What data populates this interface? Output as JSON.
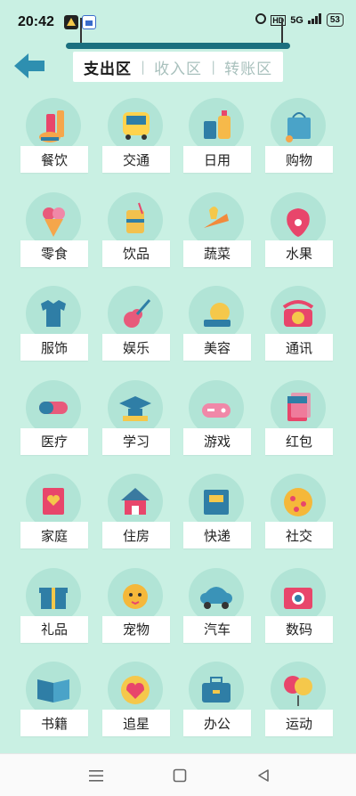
{
  "status_bar": {
    "time": "20:42",
    "battery": "53",
    "network": "5G"
  },
  "tabs": [
    {
      "label": "支出区",
      "active": true
    },
    {
      "label": "收入区",
      "active": false
    },
    {
      "label": "转账区",
      "active": false
    }
  ],
  "tab_separator": "|",
  "categories": [
    {
      "label": "餐饮",
      "icon": "food-icon",
      "color": "#f5a64b"
    },
    {
      "label": "交通",
      "icon": "bus-icon",
      "color": "#ffd34d"
    },
    {
      "label": "日用",
      "icon": "daily-goods-icon",
      "color": "#f6b94a"
    },
    {
      "label": "购物",
      "icon": "shopping-bag-icon",
      "color": "#4aa3c8"
    },
    {
      "label": "零食",
      "icon": "ice-cream-icon",
      "color": "#e85a7b"
    },
    {
      "label": "饮品",
      "icon": "drink-icon",
      "color": "#f2c14e"
    },
    {
      "label": "蔬菜",
      "icon": "vegetable-icon",
      "color": "#f28a3b"
    },
    {
      "label": "水果",
      "icon": "strawberry-icon",
      "color": "#e8466b"
    },
    {
      "label": "服饰",
      "icon": "shirt-icon",
      "color": "#2f7ea6"
    },
    {
      "label": "娱乐",
      "icon": "guitar-icon",
      "color": "#e85a7b"
    },
    {
      "label": "美容",
      "icon": "mirror-icon",
      "color": "#2f7ea6"
    },
    {
      "label": "通讯",
      "icon": "telephone-icon",
      "color": "#e8466b"
    },
    {
      "label": "医疗",
      "icon": "pill-icon",
      "color": "#e85a7b"
    },
    {
      "label": "学习",
      "icon": "graduation-cap-icon",
      "color": "#2f7ea6"
    },
    {
      "label": "游戏",
      "icon": "gamepad-icon",
      "color": "#f088a8"
    },
    {
      "label": "红包",
      "icon": "red-envelope-icon",
      "color": "#e8466b"
    },
    {
      "label": "家庭",
      "icon": "family-icon",
      "color": "#e8466b"
    },
    {
      "label": "住房",
      "icon": "house-icon",
      "color": "#3a7aa0"
    },
    {
      "label": "快递",
      "icon": "package-icon",
      "color": "#2f7ea6"
    },
    {
      "label": "社交",
      "icon": "pizza-icon",
      "color": "#f5b83a"
    },
    {
      "label": "礼品",
      "icon": "gift-icon",
      "color": "#2f7ea6"
    },
    {
      "label": "宠物",
      "icon": "pet-icon",
      "color": "#f5b83a"
    },
    {
      "label": "汽车",
      "icon": "car-icon",
      "color": "#3a93b8"
    },
    {
      "label": "数码",
      "icon": "camera-icon",
      "color": "#e8466b"
    },
    {
      "label": "书籍",
      "icon": "book-icon",
      "color": "#2f7ea6"
    },
    {
      "label": "追星",
      "icon": "heart-badge-icon",
      "color": "#e8466b"
    },
    {
      "label": "办公",
      "icon": "briefcase-icon",
      "color": "#2f7ea6"
    },
    {
      "label": "运动",
      "icon": "balloon-icon",
      "color": "#e8466b"
    }
  ],
  "colors": {
    "background": "#c9f0e3",
    "circle": "#b1e4d6",
    "rod": "#1b6f7f",
    "back_arrow": "#2e8fb0",
    "ribbon": "#3d9ed8"
  }
}
